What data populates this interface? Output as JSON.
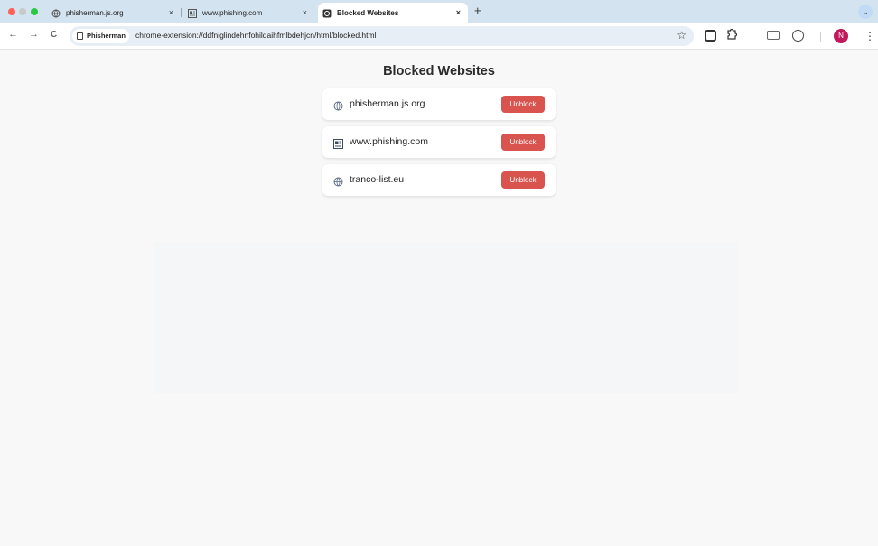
{
  "browser": {
    "tabs": [
      {
        "title": "phisherman.js.org",
        "icon": "globe-icon",
        "close": "×",
        "active": false
      },
      {
        "title": "www.phishing.com",
        "icon": "newspaper-icon",
        "close": "×",
        "active": false
      },
      {
        "title": "Blocked Websites",
        "icon": "extension-page-icon",
        "close": "×",
        "active": true
      }
    ],
    "new_tab": "+",
    "tab_menu": "⌄",
    "nav": {
      "back": "←",
      "forward": "→",
      "reload": "C"
    },
    "omnibox": {
      "chip_label": "Phisherman",
      "url": "chrome-extension://ddfniglindehnfohildaihfmlbdehjcn/html/blocked.html"
    },
    "bookmark_star": "☆",
    "profile_initial": "N",
    "menu": "⋮",
    "colors": {
      "tabstrip": "#d3e3ef",
      "avatar": "#c2185b"
    }
  },
  "page": {
    "title": "Blocked Websites",
    "sites": [
      {
        "name": "phisherman.js.org",
        "icon": "globe-icon",
        "button": "Unblock"
      },
      {
        "name": "www.phishing.com",
        "icon": "newspaper-icon",
        "button": "Unblock"
      },
      {
        "name": "tranco-list.eu",
        "icon": "globe-icon",
        "button": "Unblock"
      }
    ],
    "colors": {
      "unblock_button": "#d9534f"
    }
  }
}
